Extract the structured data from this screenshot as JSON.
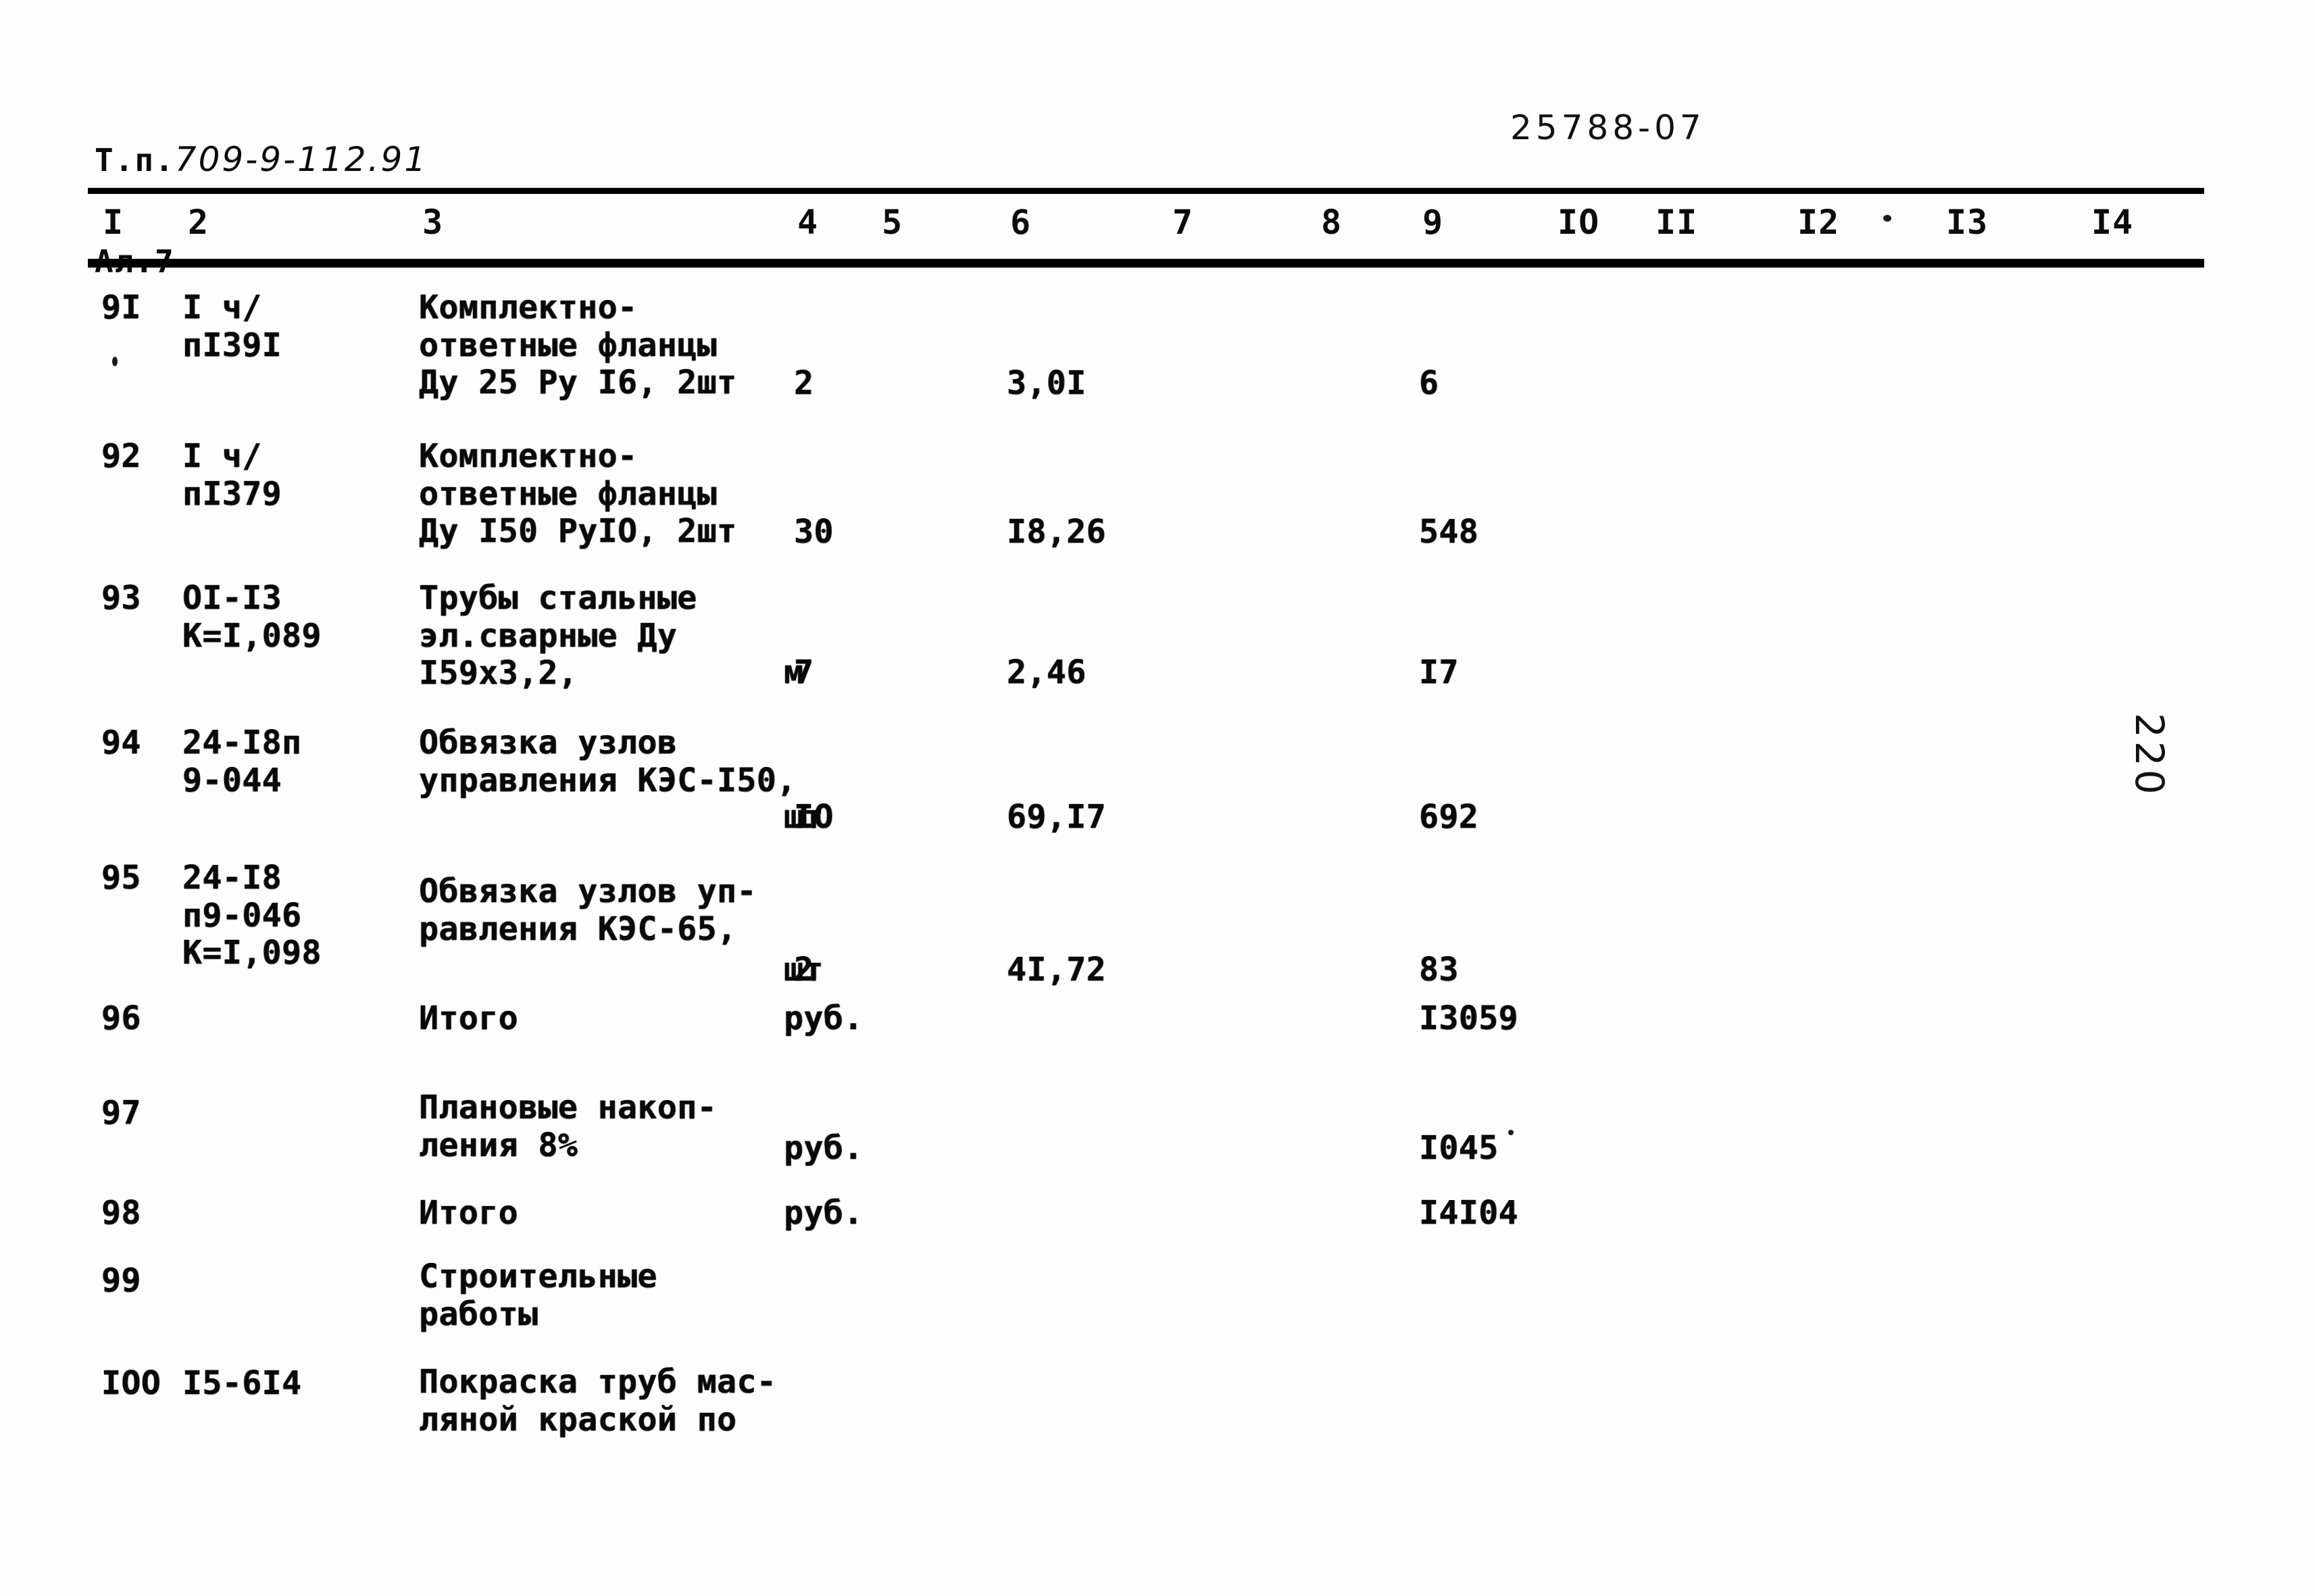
{
  "header": {
    "series_label": "Т.п.",
    "series_code": "709-9-112.91",
    "album_label": "Ал.7",
    "doc_number": "25788-07"
  },
  "page_number": "220",
  "table": {
    "column_headers": [
      "I",
      "2",
      "3",
      "4",
      "5",
      "6",
      "7",
      "8",
      "9",
      "IO",
      "II",
      "I2",
      "I3",
      "I4"
    ],
    "rows": [
      {
        "num": "9I",
        "code": "I ч/\nпI39I",
        "desc": "Комплектно-\nответные фланцы\nДу 25 Ру I6, 2шт",
        "qty": "2",
        "price": "3,0I",
        "sum": "6"
      },
      {
        "num": "92",
        "code": "I ч/\nпI379",
        "desc": "Комплектно-\nответные фланцы\nДу I50 РуIO, 2шт",
        "qty": "30",
        "price": "I8,26",
        "sum": "548"
      },
      {
        "num": "93",
        "code": "OI-I3\nК=I,089",
        "desc": "Трубы стальные\nэл.сварные Ду\nI59х3,2,",
        "unit": "м",
        "qty": "7",
        "price": "2,46",
        "sum": "I7"
      },
      {
        "num": "94",
        "code": "24-I8п\n9-044",
        "desc": "Обвязка узлов\nуправления КЭС-I50,",
        "unit": "шт",
        "qty": "IO",
        "price": "69,I7",
        "sum": "692"
      },
      {
        "num": "95",
        "code": "24-I8\nп9-046\nК=I,098",
        "desc": "Обвязка узлов уп-\nравления КЭС-65,",
        "unit": "шт",
        "qty": "2",
        "price": "4I,72",
        "sum": "83"
      },
      {
        "num": "96",
        "code": "",
        "desc": "Итого",
        "unit": "руб.",
        "qty": "",
        "price": "",
        "sum": "I3059"
      },
      {
        "num": "97",
        "code": "",
        "desc": "Плановые накоп-\nления 8%",
        "unit": "руб.",
        "qty": "",
        "price": "",
        "sum": "I045"
      },
      {
        "num": "98",
        "code": "",
        "desc": "Итого",
        "unit": "руб.",
        "qty": "",
        "price": "",
        "sum": "I4I04"
      },
      {
        "num": "99",
        "code": "",
        "desc": "Строительные\nработы",
        "unit": "",
        "qty": "",
        "price": "",
        "sum": ""
      },
      {
        "num": "IOO",
        "code": "I5-6I4",
        "desc": "Покраска труб мас-\nляной краской по",
        "unit": "",
        "qty": "",
        "price": "",
        "sum": ""
      }
    ]
  }
}
